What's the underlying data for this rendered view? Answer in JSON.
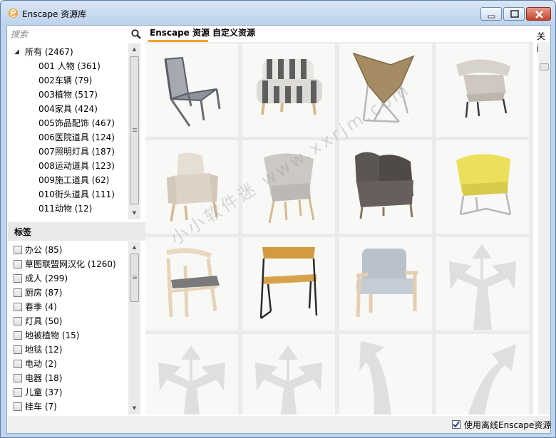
{
  "window": {
    "title": "Enscape 资源库",
    "icon": "enscape-logo-icon",
    "accent_color": "#f2a12b"
  },
  "search": {
    "placeholder": "搜索",
    "icon": "search-icon"
  },
  "category_tree": {
    "root": {
      "label": "所有 (2467)",
      "expanded": true
    },
    "items": [
      {
        "label": "001 人物 (361)"
      },
      {
        "label": "002车辆 (79)"
      },
      {
        "label": "003植物 (517)"
      },
      {
        "label": "004家具 (424)"
      },
      {
        "label": "005饰品配饰 (467)"
      },
      {
        "label": "006医院道具 (124)"
      },
      {
        "label": "007照明灯具 (187)"
      },
      {
        "label": "008运动道具 (123)"
      },
      {
        "label": "009施工道具 (62)"
      },
      {
        "label": "010街头道具 (111)"
      },
      {
        "label": "011动物 (12)"
      }
    ]
  },
  "tags": {
    "header": "标签",
    "items": [
      {
        "label": "办公 (85)",
        "checked": false
      },
      {
        "label": "草图联盟网汉化 (1260)",
        "checked": false
      },
      {
        "label": "成人 (299)",
        "checked": false
      },
      {
        "label": "厨房 (87)",
        "checked": false
      },
      {
        "label": "春季 (4)",
        "checked": false
      },
      {
        "label": "灯具 (50)",
        "checked": false
      },
      {
        "label": "地被植物 (15)",
        "checked": false
      },
      {
        "label": "地毯 (12)",
        "checked": false
      },
      {
        "label": "电动 (2)",
        "checked": false
      },
      {
        "label": "电器 (18)",
        "checked": false
      },
      {
        "label": "儿童 (37)",
        "checked": false
      },
      {
        "label": "挂车 (7)",
        "checked": false
      }
    ]
  },
  "tabs": [
    {
      "label": "Enscape 资源",
      "active": true
    },
    {
      "label": "自定义资源",
      "active": false
    }
  ],
  "close_link": "关闭",
  "assets": [
    {
      "name": "metal-frame-lounge-chair",
      "kind": "chair"
    },
    {
      "name": "striped-armchair",
      "kind": "chair"
    },
    {
      "name": "butterfly-chair",
      "kind": "chair"
    },
    {
      "name": "white-armchair",
      "kind": "chair"
    },
    {
      "name": "wingback-lounge-chair",
      "kind": "chair"
    },
    {
      "name": "grey-shell-chair",
      "kind": "chair"
    },
    {
      "name": "dark-grey-lounge-chair",
      "kind": "chair"
    },
    {
      "name": "yellow-shell-chair",
      "kind": "chair"
    },
    {
      "name": "wooden-armchair",
      "kind": "chair"
    },
    {
      "name": "metal-frame-wood-chair",
      "kind": "chair"
    },
    {
      "name": "tufted-wood-armchair",
      "kind": "chair"
    },
    {
      "name": "loading-placeholder",
      "kind": "placeholder"
    },
    {
      "name": "loading-placeholder",
      "kind": "placeholder"
    },
    {
      "name": "loading-placeholder",
      "kind": "placeholder"
    },
    {
      "name": "loading-placeholder",
      "kind": "placeholder"
    },
    {
      "name": "loading-placeholder",
      "kind": "placeholder"
    }
  ],
  "offline": {
    "label": "使用离线Enscape资源",
    "checked": true
  },
  "watermark": "小小软件迷 www.xxrjm.com"
}
